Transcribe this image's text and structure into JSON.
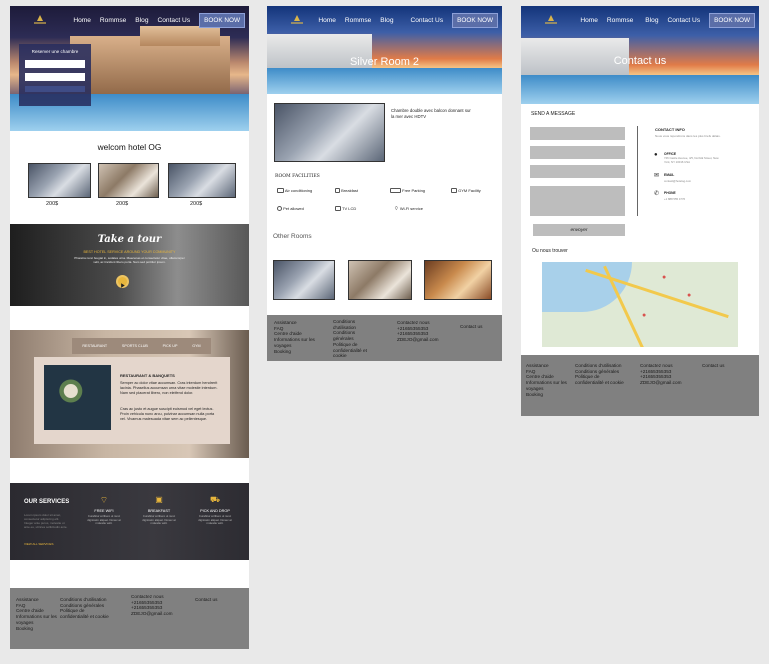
{
  "nav": {
    "links": [
      "Home",
      "Rommse",
      "Blog",
      "Contact Us"
    ],
    "book": "BOOK NOW"
  },
  "page1": {
    "booking_title": "Reserver une chambre",
    "welcome": "welcom hotel OG",
    "prices": [
      "200$",
      "200$",
      "200$"
    ],
    "tour_title": "Take a tour",
    "tour_subtitle": "BEST HOTEL SERVICE AROUND YOUR COMMUNITY",
    "tour_text": "Pharetra nunc feugiat in, sodales urna. Maecenas et consectetur vitae, ullamcorper velit, ac tincidunt libero porta. Nam sed porttitor ipsum.",
    "tabs": [
      "RESTAURANT",
      "SPORTS CLUB",
      "PICK UP",
      "GYM"
    ],
    "rb_title": "RESTAURANT & BANQUETS",
    "rb_p1": "Semper ac dolor vitae accumsan. Cras interdum hendrerit lacinia. Phasellus accumsan urna vitae molestie interdum. Nam sed placerat libero, non eleifend dolor.",
    "rb_p2": "Cras ac justo et augue suscipit euismod vel eget lectus. Proin vehicula nunc arcu, pulvinar accumsan nulla porta vel. Vivamus malesuada vitae sem ac pellentesque.",
    "services_title": "OUR SERVICES",
    "services_text": "Lorem ipsum dolor sit amet, consectetur adipiscing elit. Integer ante purus, molestie ut ante eu, ultrices sollicitudin ante.",
    "view_all": "VIEW ALL SERVICES",
    "services": [
      "FREE WIFI",
      "BREAKFAST",
      "PICK AND DROP"
    ],
    "service_desc": "Curabitur at libero ut nunc dignissim aliquet. Donec at molestie velit."
  },
  "page2": {
    "title": "Silver Room 2",
    "desc": "Chambre double avec balcon donnant sur la mer avec HDTV",
    "facilities_title": "ROOM FACILITIES",
    "facilities": [
      "Air conditioning",
      "Breakfast",
      "Free Parking",
      "GYM Facility",
      "Pet allowed",
      "TV LCD",
      "Wi-Fi service"
    ],
    "other": "Other Rooms"
  },
  "page3": {
    "title": "Contact us",
    "send": "SEND A MESSAGE",
    "send_button": "envoyer",
    "info_title": "CONTACT INFO",
    "info_text": "Nous vous répondrons dans les plus brefs délais.",
    "office_label": "OFFICE",
    "office_value": "746 Castle Avenue, 4/5, Norfolk Street, New York, NY 10016 USA",
    "email_label": "EMAIL",
    "email_value": "contact@hotelog.com",
    "phone_label": "PHONE",
    "phone_value": "+1 888 555 4776",
    "find_us": "Ou nous trouver"
  },
  "footer": {
    "col1": [
      "Assistance",
      "FAQ",
      "Centre d'aide",
      "Informations sur les voyages",
      "Booking"
    ],
    "col2": [
      "Conditions d'utilisation",
      "Conditions générales",
      "Politique de confidentialité et cookie"
    ],
    "col3": [
      "Contactez nous",
      "+21655355353",
      "+21655355353",
      "ZDEJO@gmail.com"
    ],
    "col4": [
      "Contact us"
    ]
  },
  "colors": {
    "accent": "#5b6ea8",
    "gold": "#e8b63c",
    "footer": "#808080"
  }
}
